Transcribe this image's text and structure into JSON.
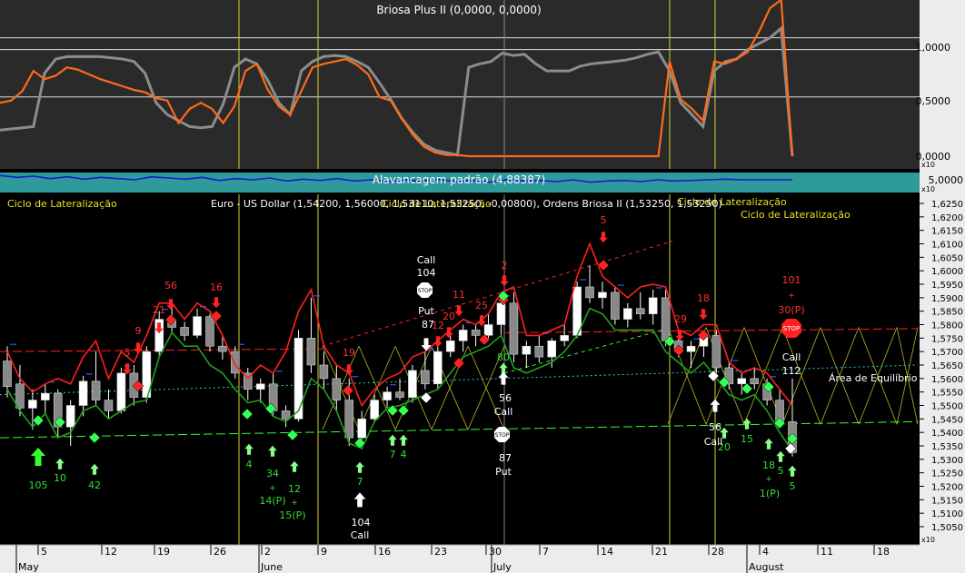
{
  "colors": {
    "background": "#000000",
    "upper_panel_bg": "#2a2a2a",
    "alav_band": "#2e9a9a",
    "axis_bg": "#ececec",
    "orange": "#ff6a1a",
    "gray_line": "#8c8c8c",
    "red": "#ff2020",
    "green": "#20a020",
    "bright_green": "#33ff33",
    "yellow_vline": "#d8d030",
    "lateral_yellow": "#b8b820",
    "cyan": "#33cccc",
    "blue_mark": "#3355ff",
    "navy": "#1a1acc"
  },
  "indicator_panel": {
    "title": "Briosa Plus II (0,0000, 0,0000)",
    "y_ticks": [
      "1,0000",
      "0,5000",
      "0,0000"
    ],
    "ylim": [
      0.0,
      1.15
    ],
    "scale_badge": "x10"
  },
  "alavancagem_panel": {
    "title": "Alavancagem padrão (4,88387)",
    "tick": "5,0000",
    "scale_badge": "x10"
  },
  "main_panel": {
    "title": "Euro - US Dollar (1,54200, 1,56000, 1,53110, 1,53250, -0,00800), Ordens Briosa II (1,53250, 1,53250)",
    "overlay_label_1": "Ciclo de Lateralização",
    "overlay_label_2": "Ciclo de Lateralização",
    "overlay_label_3": "Ciclo de Lateralização",
    "overlay_label_4": "Ciclo de Lateralização",
    "equilibrium_label": "Área de Equilíbrio",
    "y_ticks": [
      "1,6250",
      "1,6200",
      "1,6150",
      "1,6100",
      "1,6050",
      "1,6000",
      "1,5950",
      "1,5900",
      "1,5850",
      "1,5800",
      "1,5750",
      "1,5700",
      "1,5650",
      "1,5600",
      "1,5550",
      "1,5500",
      "1,5450",
      "1,5400",
      "1,5350",
      "1,5300",
      "1,5250",
      "1,5200",
      "1,5150",
      "1,5100",
      "1,5050"
    ],
    "scale_badge": "x10",
    "stop_label": "STOP"
  },
  "x_axis": {
    "day_ticks": [
      "5",
      "12",
      "19",
      "26",
      "2",
      "9",
      "16",
      "23",
      "30",
      "7",
      "14",
      "21",
      "28",
      "4",
      "11",
      "18"
    ],
    "months": [
      "May",
      "June",
      "July",
      "August"
    ]
  },
  "annotations": {
    "red": [
      "56",
      "16",
      "21",
      "9",
      "5",
      "19",
      "11",
      "20",
      "12",
      "25",
      "2",
      "5",
      "18",
      "29",
      "101",
      "+",
      "30(P)"
    ],
    "green": [
      "105",
      "10",
      "42",
      "4",
      "34",
      "+",
      "14(P)",
      "12",
      "+",
      "15(P)",
      "7",
      "7",
      "4",
      "80",
      "20",
      "15",
      "18",
      "5",
      "+",
      "1(P)",
      "5"
    ],
    "white": [
      "Call",
      "104",
      "Put",
      "87",
      "56",
      "Call",
      "87",
      "Put",
      "104",
      "Call",
      "56",
      "Call",
      "Call",
      "112"
    ]
  },
  "chart_data": [
    {
      "type": "line",
      "title": "Briosa Plus II (0,0000, 0,0000)",
      "ylim": [
        0.0,
        1.15
      ],
      "grid": true,
      "series": [
        {
          "values": [
            0.45,
            0.47,
            0.55,
            0.72,
            0.65,
            0.68,
            0.75,
            0.73,
            0.69,
            0.65,
            0.62,
            0.59,
            0.56,
            0.54,
            0.49,
            0.47,
            0.28,
            0.4,
            0.45,
            0.4,
            0.28,
            0.42,
            0.72,
            0.78,
            0.56,
            0.42,
            0.35,
            0.55,
            0.75,
            0.78,
            0.8,
            0.82,
            0.77,
            0.69,
            0.5,
            0.47,
            0.32,
            0.18,
            0.08,
            0.03,
            0.01,
            0.01,
            0.0,
            0.0,
            0.0,
            0.0,
            0.0,
            0.0,
            0.0,
            0.0,
            0.0,
            0.0,
            0.0,
            0.0,
            0.0,
            0.0,
            0.0,
            0.0,
            0.0,
            0.0,
            0.8,
            0.48,
            0.4,
            0.3,
            0.8,
            0.78,
            0.82,
            0.88,
            1.05,
            1.25,
            1.32,
            0.0
          ]
        },
        {
          "values": [
            0.22,
            0.23,
            0.24,
            0.25,
            0.7,
            0.82,
            0.84,
            0.84,
            0.84,
            0.84,
            0.83,
            0.82,
            0.8,
            0.7,
            0.45,
            0.35,
            0.3,
            0.25,
            0.24,
            0.25,
            0.44,
            0.75,
            0.82,
            0.78,
            0.64,
            0.45,
            0.35,
            0.72,
            0.8,
            0.84,
            0.85,
            0.84,
            0.8,
            0.75,
            0.62,
            0.48,
            0.32,
            0.2,
            0.1,
            0.05,
            0.03,
            0.01,
            0.75,
            0.78,
            0.8,
            0.87,
            0.85,
            0.86,
            0.78,
            0.72,
            0.72,
            0.72,
            0.76,
            0.78,
            0.79,
            0.8,
            0.81,
            0.83,
            0.86,
            0.88,
            0.72,
            0.45,
            0.35,
            0.25,
            0.72,
            0.8,
            0.82,
            0.9,
            0.95,
            1.0,
            1.08,
            0.0
          ]
        }
      ]
    },
    {
      "type": "line",
      "title": "Alavancagem padrão (4,88387)",
      "series": [
        {
          "values": [
            4.95,
            4.92,
            4.94,
            4.9,
            4.93,
            4.89,
            4.92,
            4.9,
            4.88,
            4.93,
            4.91,
            4.89,
            4.92,
            4.87,
            4.9,
            4.88,
            4.91,
            4.86,
            4.89,
            4.87,
            4.9,
            4.86,
            4.88,
            4.85,
            4.88,
            4.86,
            4.89,
            4.85,
            4.87,
            4.84,
            4.88,
            4.86,
            4.87,
            4.85,
            4.88,
            4.84,
            4.86,
            4.87,
            4.85,
            4.88,
            4.86,
            4.87,
            4.88,
            4.89,
            4.88,
            4.88,
            4.88,
            4.88
          ]
        }
      ]
    },
    {
      "type": "candlestick",
      "title": "Euro - US Dollar (1,54200, 1,56000, 1,53110, 1,53250, -0,00800), Ordens Briosa II (1,53250, 1,53250)",
      "ylim": [
        1.5025,
        1.6275
      ],
      "x_ticks": [
        "5",
        "12",
        "19",
        "26",
        "2",
        "9",
        "16",
        "23",
        "30",
        "7",
        "14",
        "21",
        "28",
        "4",
        "11",
        "18"
      ],
      "ohlc": [
        [
          1.5665,
          1.572,
          1.553,
          1.557
        ],
        [
          1.558,
          1.565,
          1.546,
          1.549
        ],
        [
          1.549,
          1.556,
          1.541,
          1.552
        ],
        [
          1.552,
          1.558,
          1.547,
          1.5545
        ],
        [
          1.5545,
          1.556,
          1.538,
          1.542
        ],
        [
          1.542,
          1.552,
          1.535,
          1.55
        ],
        [
          1.55,
          1.561,
          1.546,
          1.559
        ],
        [
          1.559,
          1.57,
          1.55,
          1.552
        ],
        [
          1.552,
          1.556,
          1.545,
          1.548
        ],
        [
          1.548,
          1.564,
          1.547,
          1.562
        ],
        [
          1.562,
          1.565,
          1.55,
          1.553
        ],
        [
          1.553,
          1.572,
          1.551,
          1.57
        ],
        [
          1.57,
          1.585,
          1.568,
          1.582
        ],
        [
          1.582,
          1.587,
          1.577,
          1.579
        ],
        [
          1.579,
          1.581,
          1.574,
          1.576
        ],
        [
          1.576,
          1.586,
          1.575,
          1.583
        ],
        [
          1.583,
          1.584,
          1.57,
          1.572
        ],
        [
          1.572,
          1.576,
          1.567,
          1.57
        ],
        [
          1.57,
          1.572,
          1.56,
          1.562
        ],
        [
          1.562,
          1.564,
          1.552,
          1.556
        ],
        [
          1.556,
          1.56,
          1.551,
          1.558
        ],
        [
          1.558,
          1.562,
          1.546,
          1.548
        ],
        [
          1.548,
          1.55,
          1.542,
          1.545
        ],
        [
          1.545,
          1.578,
          1.544,
          1.575
        ],
        [
          1.575,
          1.59,
          1.562,
          1.565
        ],
        [
          1.565,
          1.57,
          1.556,
          1.56
        ],
        [
          1.56,
          1.565,
          1.548,
          1.552
        ],
        [
          1.552,
          1.56,
          1.535,
          1.538
        ],
        [
          1.538,
          1.548,
          1.536,
          1.545
        ],
        [
          1.545,
          1.554,
          1.544,
          1.552
        ],
        [
          1.552,
          1.557,
          1.549,
          1.555
        ],
        [
          1.555,
          1.56,
          1.552,
          1.553
        ],
        [
          1.553,
          1.565,
          1.551,
          1.563
        ],
        [
          1.563,
          1.57,
          1.556,
          1.558
        ],
        [
          1.558,
          1.572,
          1.556,
          1.57
        ],
        [
          1.57,
          1.576,
          1.568,
          1.574
        ],
        [
          1.574,
          1.58,
          1.57,
          1.578
        ],
        [
          1.578,
          1.58,
          1.572,
          1.576
        ],
        [
          1.576,
          1.584,
          1.574,
          1.58
        ],
        [
          1.58,
          1.59,
          1.576,
          1.588
        ],
        [
          1.588,
          1.592,
          1.566,
          1.569
        ],
        [
          1.569,
          1.574,
          1.564,
          1.572
        ],
        [
          1.572,
          1.576,
          1.566,
          1.568
        ],
        [
          1.568,
          1.575,
          1.564,
          1.574
        ],
        [
          1.574,
          1.58,
          1.572,
          1.576
        ],
        [
          1.576,
          1.596,
          1.575,
          1.594
        ],
        [
          1.594,
          1.602,
          1.588,
          1.59
        ],
        [
          1.59,
          1.596,
          1.586,
          1.592
        ],
        [
          1.592,
          1.594,
          1.58,
          1.582
        ],
        [
          1.582,
          1.588,
          1.579,
          1.586
        ],
        [
          1.586,
          1.592,
          1.582,
          1.584
        ],
        [
          1.584,
          1.593,
          1.58,
          1.59
        ],
        [
          1.59,
          1.593,
          1.572,
          1.574
        ],
        [
          1.574,
          1.576,
          1.568,
          1.57
        ],
        [
          1.57,
          1.574,
          1.564,
          1.572
        ],
        [
          1.572,
          1.578,
          1.568,
          1.576
        ],
        [
          1.576,
          1.578,
          1.562,
          1.564
        ],
        [
          1.564,
          1.566,
          1.556,
          1.558
        ],
        [
          1.558,
          1.562,
          1.554,
          1.56
        ],
        [
          1.56,
          1.564,
          1.556,
          1.558
        ],
        [
          1.558,
          1.56,
          1.55,
          1.552
        ],
        [
          1.552,
          1.556,
          1.542,
          1.544
        ],
        [
          1.544,
          1.56,
          1.5311,
          1.5325
        ]
      ],
      "upper_line": [
        1.57,
        1.56,
        1.555,
        1.558,
        1.56,
        1.558,
        1.568,
        1.574,
        1.56,
        1.57,
        1.566,
        1.576,
        1.588,
        1.588,
        1.582,
        1.588,
        1.585,
        1.576,
        1.565,
        1.56,
        1.565,
        1.562,
        1.57,
        1.585,
        1.593,
        1.572,
        1.565,
        1.562,
        1.55,
        1.556,
        1.56,
        1.562,
        1.568,
        1.57,
        1.574,
        1.578,
        1.582,
        1.58,
        1.584,
        1.592,
        1.594,
        1.576,
        1.576,
        1.578,
        1.58,
        1.598,
        1.61,
        1.598,
        1.594,
        1.59,
        1.594,
        1.595,
        1.594,
        1.578,
        1.576,
        1.58,
        1.58,
        1.566,
        1.562,
        1.564,
        1.562,
        1.556,
        1.55
      ],
      "lower_line": [
        1.556,
        1.548,
        1.542,
        1.547,
        1.538,
        1.54,
        1.548,
        1.55,
        1.545,
        1.548,
        1.551,
        1.552,
        1.568,
        1.577,
        1.572,
        1.572,
        1.565,
        1.562,
        1.556,
        1.551,
        1.552,
        1.546,
        1.544,
        1.548,
        1.56,
        1.556,
        1.548,
        1.536,
        1.534,
        1.544,
        1.549,
        1.55,
        1.552,
        1.554,
        1.556,
        1.562,
        1.568,
        1.57,
        1.572,
        1.576,
        1.564,
        1.562,
        1.564,
        1.566,
        1.57,
        1.576,
        1.586,
        1.584,
        1.578,
        1.578,
        1.578,
        1.578,
        1.57,
        1.566,
        1.562,
        1.566,
        1.56,
        1.554,
        1.552,
        1.554,
        1.548,
        1.54,
        1.533
      ]
    }
  ]
}
